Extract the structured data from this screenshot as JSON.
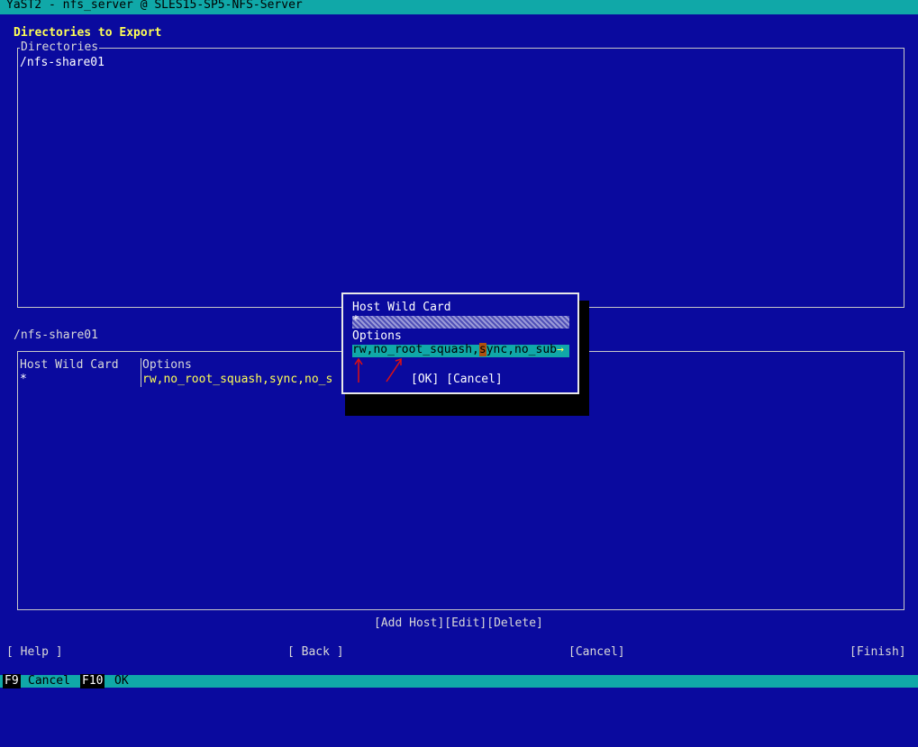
{
  "window": {
    "title": "YaST2 - nfs_server @ SLES15-SP5-NFS-Server"
  },
  "main": {
    "heading": "Directories to Export",
    "directories_frame_label": "Directories",
    "directories": [
      "/nfs-share01"
    ],
    "hosts_label": "/nfs-share01",
    "hosts_table": {
      "columns": [
        "Host Wild Card",
        "Options"
      ],
      "rows": [
        {
          "host": "*",
          "options": "rw,no_root_squash,sync,no_s"
        }
      ]
    },
    "host_buttons": {
      "add": "[Add Host]",
      "edit": "[Edit]",
      "delete": "[Delete]"
    }
  },
  "dialog": {
    "host_label": "Host Wild Card",
    "host_value": "*",
    "options_label": "Options",
    "options_value_before": "rw,no_root_squash,",
    "options_value_cursor": "s",
    "options_value_after": "ync,no_sub",
    "options_overflow_marker": "→",
    "ok": "[OK]",
    "cancel": "[Cancel]"
  },
  "nav": {
    "help": "[ Help ]",
    "back": "[ Back ]",
    "cancel": "[Cancel]",
    "finish": "[Finish]"
  },
  "footer": {
    "f9_key": "F9",
    "f9_label": "Cancel",
    "f10_key": "F10",
    "f10_label": "OK"
  },
  "colors": {
    "background": "#0a0a9e",
    "titlebar": "#10a8a8",
    "highlight": "#ffff55",
    "annotation_arrow": "#e01010"
  }
}
